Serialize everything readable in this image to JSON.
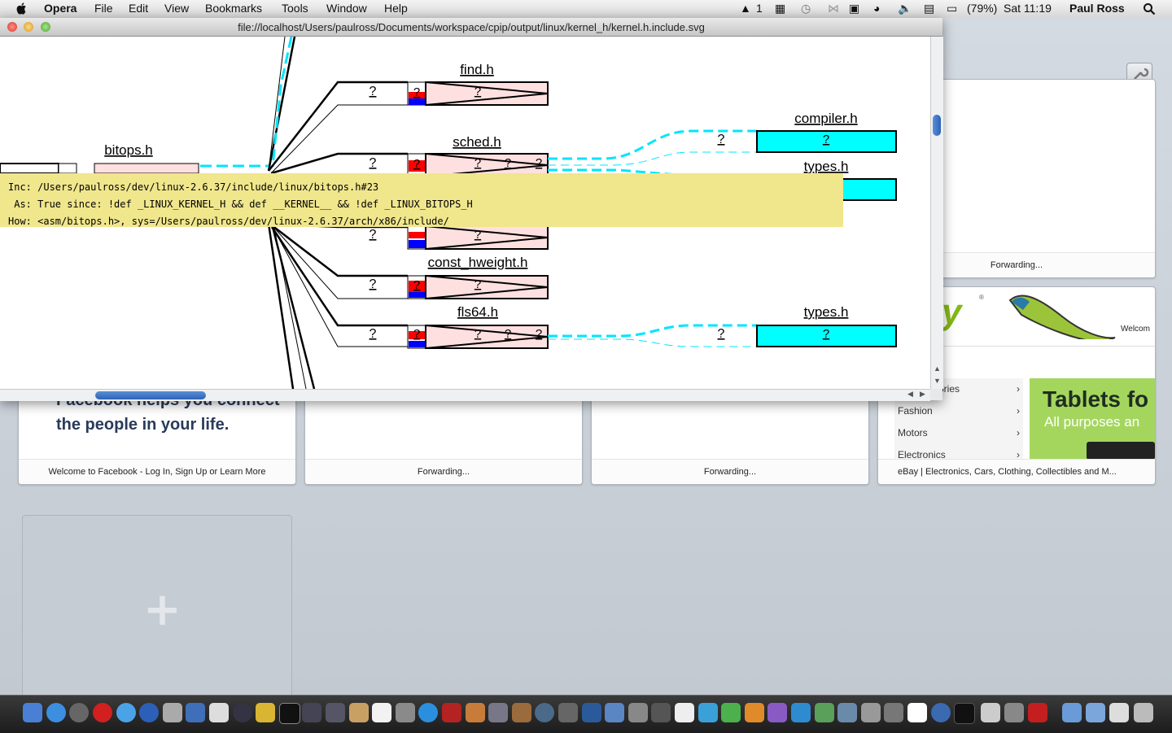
{
  "menubar": {
    "app": "Opera",
    "items": [
      "File",
      "Edit",
      "View",
      "Bookmarks",
      "Tools",
      "Window",
      "Help"
    ],
    "status": {
      "space": "1",
      "battery": "(79%)",
      "clock": "Sat 11:19",
      "user": "Paul Ross"
    }
  },
  "window": {
    "url": "file://localhost/Users/paulross/Documents/workspace/cpip/output/linux/kernel_h/kernel.h.include.svg"
  },
  "graph": {
    "nodes": {
      "bitops": "bitops.h",
      "find": "find.h",
      "sched": "sched.h",
      "compiler": "compiler.h",
      "types1": "types.h",
      "const_hweight": "const_hweight.h",
      "fls64": "fls64.h",
      "types2": "types.h"
    },
    "q": "?"
  },
  "tooltip": {
    "line1": "Inc: /Users/paulross/dev/linux-2.6.37/include/linux/bitops.h#23",
    "line2": " As: True since: !def _LINUX_KERNEL_H && def __KERNEL__ && !def _LINUX_BITOPS_H",
    "line3": "How: <asm/bitops.h>, sys=/Users/paulross/dev/linux-2.6.37/arch/x86/include/"
  },
  "speeddial": {
    "tiles": [
      {
        "caption": "Forwarding..."
      },
      {
        "caption": "Welcome to Facebook - Log In, Sign Up or Learn More",
        "headline1": "Facebook helps you connect",
        "headline2": "the people in your life."
      },
      {
        "caption": "Forwarding..."
      },
      {
        "caption": "Forwarding..."
      },
      {
        "caption": "eBay | Electronics, Cars, Clothing, Collectibles and M...",
        "welcome": "Welcom",
        "cats": [
          "ories",
          "Fashion",
          "Motors",
          "Electronics"
        ],
        "ad1": "Tablets fo",
        "ad2": "All purposes an"
      }
    ]
  },
  "colors": {
    "tooltip": "#f0e68c",
    "cyan": "#00ffff",
    "pink": "#ffe0e0"
  }
}
